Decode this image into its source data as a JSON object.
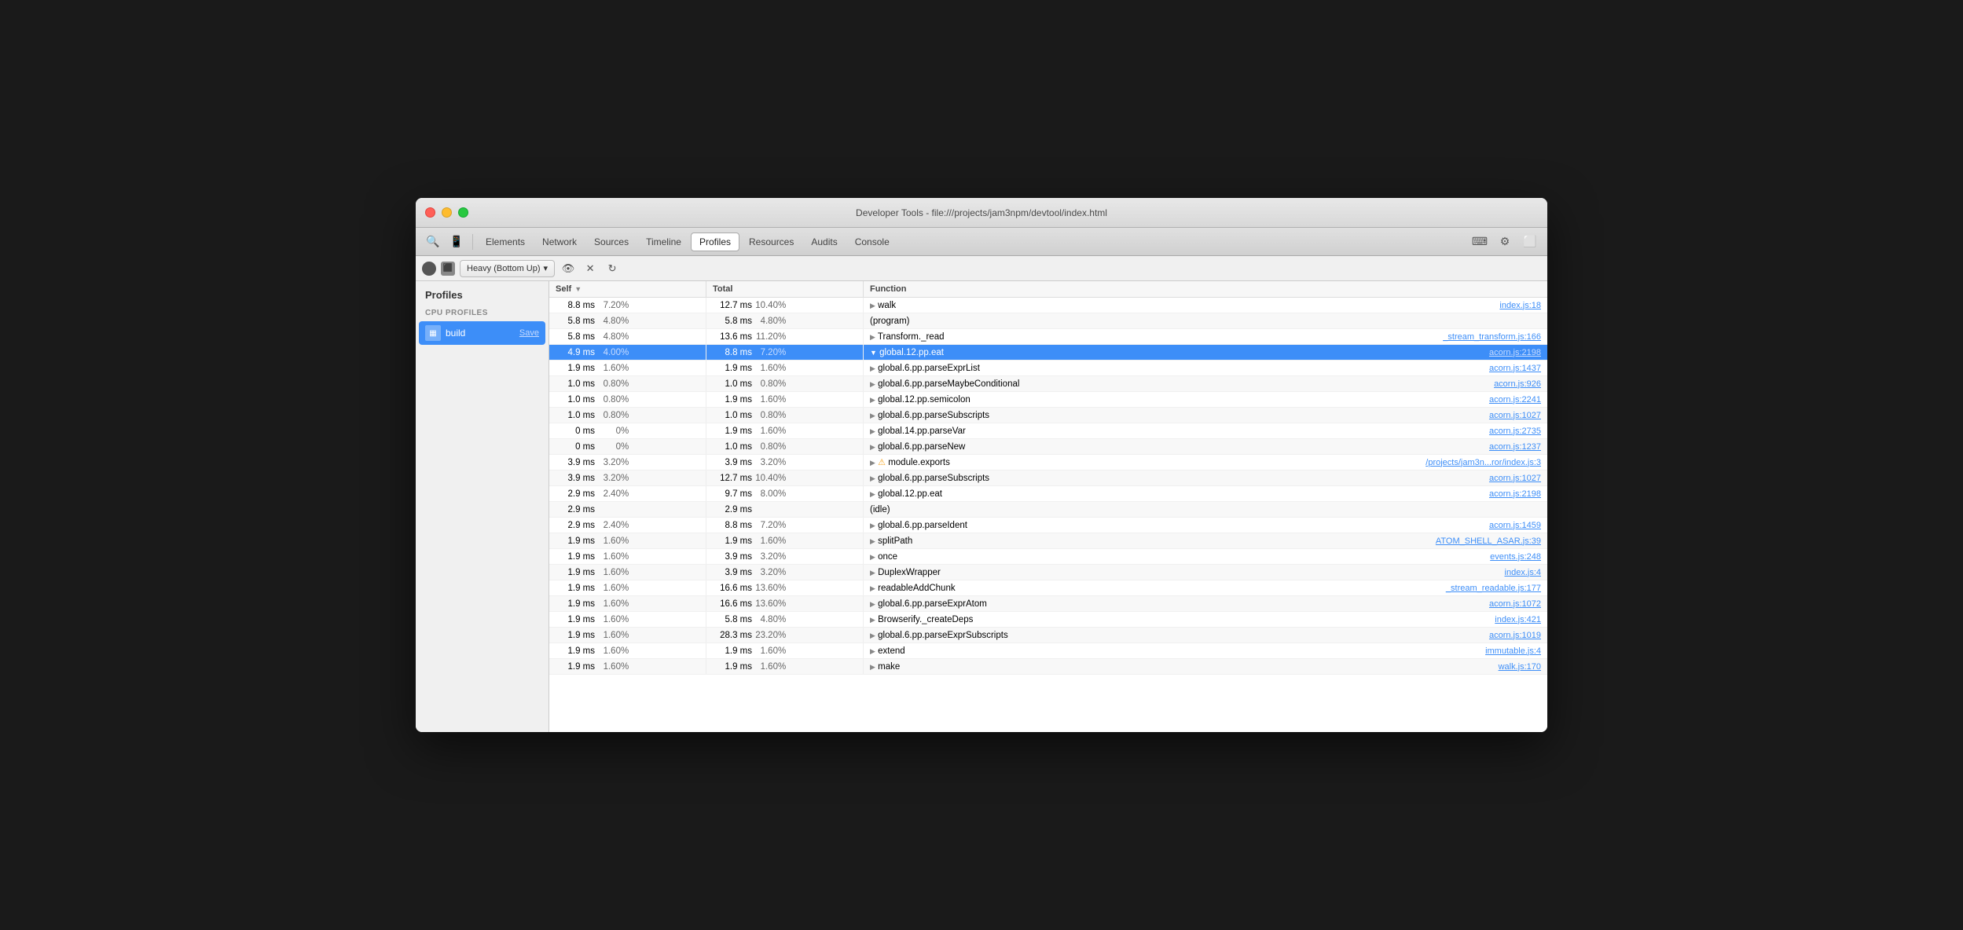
{
  "window": {
    "title": "Developer Tools - file:///projects/jam3npm/devtool/index.html"
  },
  "toolbar": {
    "tabs": [
      {
        "label": "Elements",
        "active": false
      },
      {
        "label": "Network",
        "active": false
      },
      {
        "label": "Sources",
        "active": false
      },
      {
        "label": "Timeline",
        "active": false
      },
      {
        "label": "Profiles",
        "active": true
      },
      {
        "label": "Resources",
        "active": false
      },
      {
        "label": "Audits",
        "active": false
      },
      {
        "label": "Console",
        "active": false
      }
    ]
  },
  "subtoolbar": {
    "dropdown_label": "Heavy (Bottom Up)",
    "dropdown_arrow": "▾"
  },
  "sidebar": {
    "header": "Profiles",
    "section_label": "CPU PROFILES",
    "items": [
      {
        "name": "build",
        "save_label": "Save",
        "selected": true
      }
    ]
  },
  "table": {
    "columns": [
      {
        "label": "Self",
        "sort": true
      },
      {
        "label": "Total"
      },
      {
        "label": "Function"
      }
    ],
    "rows": [
      {
        "self_val": "8.8 ms",
        "self_pct": "7.20%",
        "total_val": "12.7 ms",
        "total_pct": "10.40%",
        "fn": "walk",
        "fn_prefix": "▶",
        "file": "index.js:18",
        "striped": false,
        "selected": false
      },
      {
        "self_val": "5.8 ms",
        "self_pct": "4.80%",
        "total_val": "5.8 ms",
        "total_pct": "4.80%",
        "fn": "(program)",
        "fn_prefix": "",
        "file": "",
        "striped": true,
        "selected": false
      },
      {
        "self_val": "5.8 ms",
        "self_pct": "4.80%",
        "total_val": "13.6 ms",
        "total_pct": "11.20%",
        "fn": "Transform._read",
        "fn_prefix": "▶",
        "file": "_stream_transform.js:166",
        "striped": false,
        "selected": false
      },
      {
        "self_val": "4.9 ms",
        "self_pct": "4.00%",
        "total_val": "8.8 ms",
        "total_pct": "7.20%",
        "fn": "global.12.pp.eat",
        "fn_prefix": "▼",
        "file": "acorn.js:2198",
        "striped": false,
        "selected": true
      },
      {
        "self_val": "1.9 ms",
        "self_pct": "1.60%",
        "total_val": "1.9 ms",
        "total_pct": "1.60%",
        "fn": "global.6.pp.parseExprList",
        "fn_prefix": "▶",
        "file": "acorn.js:1437",
        "striped": false,
        "selected": false
      },
      {
        "self_val": "1.0 ms",
        "self_pct": "0.80%",
        "total_val": "1.0 ms",
        "total_pct": "0.80%",
        "fn": "global.6.pp.parseMaybeConditional",
        "fn_prefix": "▶",
        "file": "acorn.js:926",
        "striped": true,
        "selected": false
      },
      {
        "self_val": "1.0 ms",
        "self_pct": "0.80%",
        "total_val": "1.9 ms",
        "total_pct": "1.60%",
        "fn": "global.12.pp.semicolon",
        "fn_prefix": "▶",
        "file": "acorn.js:2241",
        "striped": false,
        "selected": false
      },
      {
        "self_val": "1.0 ms",
        "self_pct": "0.80%",
        "total_val": "1.0 ms",
        "total_pct": "0.80%",
        "fn": "global.6.pp.parseSubscripts",
        "fn_prefix": "▶",
        "file": "acorn.js:1027",
        "striped": true,
        "selected": false
      },
      {
        "self_val": "0 ms",
        "self_pct": "0%",
        "total_val": "1.9 ms",
        "total_pct": "1.60%",
        "fn": "global.14.pp.parseVar",
        "fn_prefix": "▶",
        "file": "acorn.js:2735",
        "striped": false,
        "selected": false
      },
      {
        "self_val": "0 ms",
        "self_pct": "0%",
        "total_val": "1.0 ms",
        "total_pct": "0.80%",
        "fn": "global.6.pp.parseNew",
        "fn_prefix": "▶",
        "file": "acorn.js:1237",
        "striped": true,
        "selected": false
      },
      {
        "self_val": "3.9 ms",
        "self_pct": "3.20%",
        "total_val": "3.9 ms",
        "total_pct": "3.20%",
        "fn": "module.exports",
        "fn_prefix": "▶⚠",
        "file": "/projects/jam3n...ror/index.js:3",
        "striped": false,
        "selected": false
      },
      {
        "self_val": "3.9 ms",
        "self_pct": "3.20%",
        "total_val": "12.7 ms",
        "total_pct": "10.40%",
        "fn": "global.6.pp.parseSubscripts",
        "fn_prefix": "▶",
        "file": "acorn.js:1027",
        "striped": true,
        "selected": false
      },
      {
        "self_val": "2.9 ms",
        "self_pct": "2.40%",
        "total_val": "9.7 ms",
        "total_pct": "8.00%",
        "fn": "global.12.pp.eat",
        "fn_prefix": "▶",
        "file": "acorn.js:2198",
        "striped": false,
        "selected": false
      },
      {
        "self_val": "2.9 ms",
        "self_pct": "",
        "total_val": "2.9 ms",
        "total_pct": "",
        "fn": "(idle)",
        "fn_prefix": "",
        "file": "",
        "striped": true,
        "selected": false
      },
      {
        "self_val": "2.9 ms",
        "self_pct": "2.40%",
        "total_val": "8.8 ms",
        "total_pct": "7.20%",
        "fn": "global.6.pp.parseIdent",
        "fn_prefix": "▶",
        "file": "acorn.js:1459",
        "striped": false,
        "selected": false
      },
      {
        "self_val": "1.9 ms",
        "self_pct": "1.60%",
        "total_val": "1.9 ms",
        "total_pct": "1.60%",
        "fn": "splitPath",
        "fn_prefix": "▶",
        "file": "ATOM_SHELL_ASAR.js:39",
        "striped": true,
        "selected": false
      },
      {
        "self_val": "1.9 ms",
        "self_pct": "1.60%",
        "total_val": "3.9 ms",
        "total_pct": "3.20%",
        "fn": "once",
        "fn_prefix": "▶",
        "file": "events.js:248",
        "striped": false,
        "selected": false
      },
      {
        "self_val": "1.9 ms",
        "self_pct": "1.60%",
        "total_val": "3.9 ms",
        "total_pct": "3.20%",
        "fn": "DuplexWrapper",
        "fn_prefix": "▶",
        "file": "index.js:4",
        "striped": true,
        "selected": false
      },
      {
        "self_val": "1.9 ms",
        "self_pct": "1.60%",
        "total_val": "16.6 ms",
        "total_pct": "13.60%",
        "fn": "readableAddChunk",
        "fn_prefix": "▶",
        "file": "_stream_readable.js:177",
        "striped": false,
        "selected": false
      },
      {
        "self_val": "1.9 ms",
        "self_pct": "1.60%",
        "total_val": "16.6 ms",
        "total_pct": "13.60%",
        "fn": "global.6.pp.parseExprAtom",
        "fn_prefix": "▶",
        "file": "acorn.js:1072",
        "striped": true,
        "selected": false
      },
      {
        "self_val": "1.9 ms",
        "self_pct": "1.60%",
        "total_val": "5.8 ms",
        "total_pct": "4.80%",
        "fn": "Browserify._createDeps",
        "fn_prefix": "▶",
        "file": "index.js:421",
        "striped": false,
        "selected": false
      },
      {
        "self_val": "1.9 ms",
        "self_pct": "1.60%",
        "total_val": "28.3 ms",
        "total_pct": "23.20%",
        "fn": "global.6.pp.parseExprSubscripts",
        "fn_prefix": "▶",
        "file": "acorn.js:1019",
        "striped": true,
        "selected": false
      },
      {
        "self_val": "1.9 ms",
        "self_pct": "1.60%",
        "total_val": "1.9 ms",
        "total_pct": "1.60%",
        "fn": "extend",
        "fn_prefix": "▶",
        "file": "immutable.js:4",
        "striped": false,
        "selected": false
      },
      {
        "self_val": "1.9 ms",
        "self_pct": "1.60%",
        "total_val": "1.9 ms",
        "total_pct": "1.60%",
        "fn": "make",
        "fn_prefix": "▶",
        "file": "walk.js:170",
        "striped": true,
        "selected": false
      }
    ]
  }
}
